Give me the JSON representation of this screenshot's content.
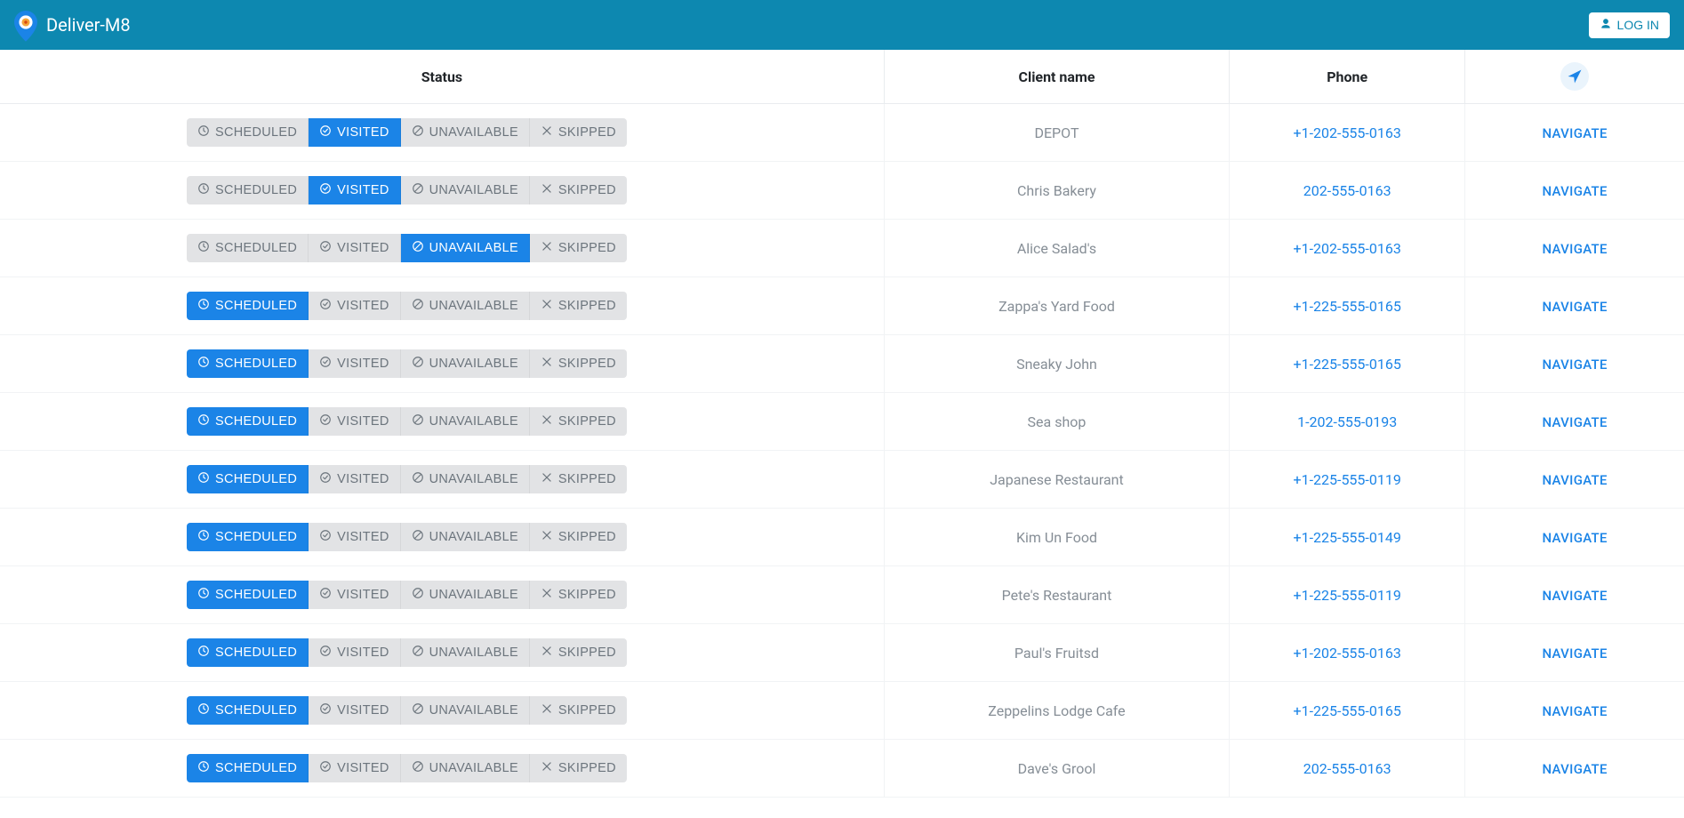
{
  "header": {
    "brand": "Deliver-M8",
    "login_label": "LOG IN"
  },
  "columns": {
    "status": "Status",
    "client": "Client name",
    "phone": "Phone",
    "navigate_title": "Navigate"
  },
  "status_labels": {
    "scheduled": "SCHEDULED",
    "visited": "VISITED",
    "unavailable": "UNAVAILABLE",
    "skipped": "SKIPPED"
  },
  "navigate_label": "NAVIGATE",
  "rows": [
    {
      "client": "DEPOT",
      "phone": "+1-202-555-0163",
      "active": "visited"
    },
    {
      "client": "Chris Bakery",
      "phone": "202-555-0163",
      "active": "visited"
    },
    {
      "client": "Alice Salad's",
      "phone": "+1-202-555-0163",
      "active": "unavailable"
    },
    {
      "client": "Zappa's Yard Food",
      "phone": "+1-225-555-0165",
      "active": "scheduled"
    },
    {
      "client": "Sneaky John",
      "phone": "+1-225-555-0165",
      "active": "scheduled"
    },
    {
      "client": "Sea shop",
      "phone": "1-202-555-0193",
      "active": "scheduled"
    },
    {
      "client": "Japanese Restaurant",
      "phone": "+1-225-555-0119",
      "active": "scheduled"
    },
    {
      "client": "Kim Un Food",
      "phone": "+1-225-555-0149",
      "active": "scheduled"
    },
    {
      "client": "Pete's Restaurant",
      "phone": "+1-225-555-0119",
      "active": "scheduled"
    },
    {
      "client": "Paul's Fruitsd",
      "phone": "+1-202-555-0163",
      "active": "scheduled"
    },
    {
      "client": "Zeppelins Lodge Cafe",
      "phone": "+1-225-555-0165",
      "active": "scheduled"
    },
    {
      "client": "Dave's Grool",
      "phone": "202-555-0163",
      "active": "scheduled"
    }
  ]
}
